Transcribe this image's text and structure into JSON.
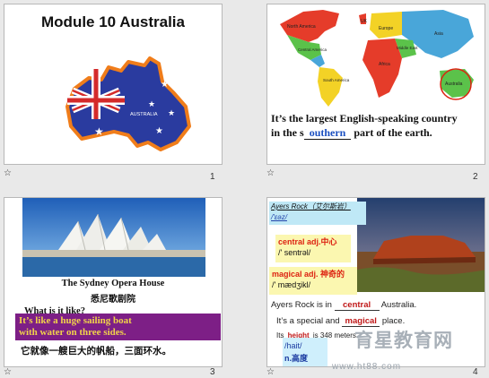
{
  "slides": [
    {
      "number": "1",
      "title": "Module 10 Australia",
      "map_label": "AUSTRALIA"
    },
    {
      "number": "2",
      "map_labels": [
        "North America",
        "UK",
        "Europe",
        "Asia",
        "Central America",
        "Middle East",
        "Africa",
        "South America",
        "Australia"
      ],
      "text_line1": "It’s the largest English-speaking country",
      "text_line2_before": "in the  s",
      "blank_answer": "outhern",
      "text_line2_after": "  part of the earth."
    },
    {
      "number": "3",
      "caption": "The Sydney Opera House",
      "caption_cn": "悉尼歌剧院",
      "question": "What is it like?",
      "answer_line1": "It’s like a huge sailing boat",
      "answer_line2": "with water on three sides.",
      "answer_cn": "它就像一艘巨大的帆船，三面环水。"
    },
    {
      "number": "4",
      "ayers_heading": "Ayers Rock（艾尔斯岩）",
      "ayers_ipa": "/'ɛəz/",
      "note1_word": "central adj.中心",
      "note1_ipa": "/' sentrəl/",
      "note2_word": "magical adj. 神奇的",
      "note2_ipa": "/' mædʒikl/",
      "line1_before": "Ayers Rock is in ",
      "line1_blank": "central",
      "line1_after": " Australia.",
      "line2_before": "It’s a special and ",
      "line2_blank": "magical",
      "line2_after": " place.",
      "line3_before": "Its ",
      "line3_blank": "height",
      "line3_after": " is 348 meters.",
      "height_ipa": "/hait/",
      "height_cn": "n.高度"
    }
  ],
  "watermark": "育星教育网",
  "watermark_url": "www.ht88.com"
}
